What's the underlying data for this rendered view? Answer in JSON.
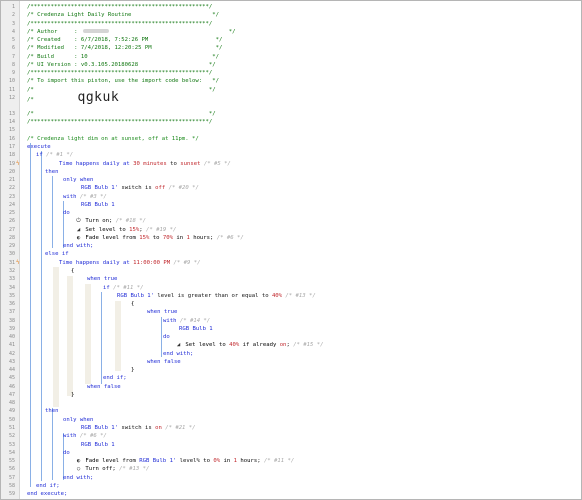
{
  "header": {
    "border": "/*****************************************************/",
    "title": "/* Credenza Light Daily Routine                        */",
    "author_label": "/* Author     : ",
    "author_tail": "                                   */",
    "created": "/* Created    : 6/7/2018, 7:52:26 PM                    */",
    "modified": "/* Modified   : 7/4/2018, 12:20:25 PM                   */",
    "build": "/* Build      : 10                                     */",
    "ui_version": "/* UI Version : v0.3.105.20180628                     */",
    "import_line": "/* To import this piston, use the import code below:   */",
    "blank": "/*                                                    */",
    "code_prefix": "/*             ",
    "import_code": "qgkuk",
    "code_suffix": "                                      */"
  },
  "comment": "/* Credenza light dim on at sunset, off at 11pm. */",
  "lines": {
    "l18": "execute",
    "l19_if": "if",
    "l19_c": "/* #1 */",
    "l20_a": "Time happens daily at ",
    "l20_b": "30 minutes",
    "l20_c": " to ",
    "l20_d": "sunset",
    "l20_e": "/* #5 */",
    "l21": "then",
    "l22_a": "only when",
    "l23_a": "RGB Bulb 1'",
    "l23_b": " switch is ",
    "l23_c": "off",
    "l23_d": "/* #20 */",
    "l24_a": "with",
    "l24_b": "/* #3 */",
    "l25": "RGB Bulb 1",
    "l26_k": "do",
    "l27_a": "Turn on;",
    "l27_b": "/* #18 */",
    "l28_a": "Set level to ",
    "l28_b": "15%",
    "l28_c": ";",
    "l28_d": "/* #19 */",
    "l29_a": "Fade level from ",
    "l29_b": "15%",
    "l29_c": " to ",
    "l29_d": "70%",
    "l29_e": " in ",
    "l29_f": "1",
    "l29_g": " hours;",
    "l29_h": "/* #6 */",
    "l30": "end with;",
    "l31": "else if",
    "l32_a": "Time happens daily at ",
    "l32_b": "11:00:00 PM",
    "l32_c": "/* #9 */",
    "l33": "{",
    "l34": "when true",
    "l35_a": "if",
    "l35_b": "/* #11 */",
    "l36_a": "RGB Bulb 1'",
    "l36_b": " level",
    "l36_c": " is greater than or equal to ",
    "l36_d": "40%",
    "l36_e": "/* #13 */",
    "l37": "{",
    "l38": "when true",
    "l39_a": "with",
    "l39_b": "/* #14 */",
    "l40": "RGB Bulb 1",
    "l41": "do",
    "l42_a": "Set level to ",
    "l42_b": "40%",
    "l42_c": " if already ",
    "l42_d": "on",
    "l42_e": ";",
    "l42_f": "/* #15 */",
    "l43": "end with;",
    "l44": "when false",
    "l45": "}",
    "l46": "end if;",
    "l47": "when false",
    "l48": "}",
    "l50": "then",
    "l51": "only when",
    "l52_a": "RGB Bulb 1'",
    "l52_b": " switch is ",
    "l52_c": "on",
    "l52_d": "/* #21 */",
    "l53_a": "with",
    "l53_b": "/* #6 */",
    "l54": "RGB Bulb 1",
    "l55": "do",
    "l56_a": "Fade level from ",
    "l56_b": "RGB Bulb 1'",
    "l56_c": " level%",
    "l56_d": " to ",
    "l56_e": "0%",
    "l56_f": " in ",
    "l56_g": "1",
    "l56_h": " hours;",
    "l56_i": "/* #11 */",
    "l57_a": "Turn off;",
    "l57_b": "/* #13 */",
    "l58": "end with;",
    "l59": "end if;",
    "l60": "end execute;"
  },
  "line_numbers": [
    "1",
    "2",
    "3",
    "4",
    "5",
    "6",
    "7",
    "8",
    "9",
    "10",
    "11",
    "12",
    "13",
    "14",
    "15",
    "16",
    "17",
    "18",
    "19",
    "20",
    "21",
    "22",
    "23",
    "24",
    "25",
    "26",
    "27",
    "28",
    "29",
    "30",
    "31",
    "32",
    "33",
    "34",
    "35",
    "36",
    "37",
    "38",
    "39",
    "40",
    "41",
    "42",
    "43",
    "44",
    "45",
    "46",
    "47",
    "48",
    "49",
    "50",
    "51",
    "52",
    "53",
    "54",
    "55",
    "56",
    "57",
    "58",
    "59",
    "60"
  ],
  "colors": {
    "keyword": "#1f2bd6",
    "value": "#c0262b",
    "comment": "#1a8a1a",
    "guide": "#8ab0e6",
    "marker": "#e8892d"
  }
}
